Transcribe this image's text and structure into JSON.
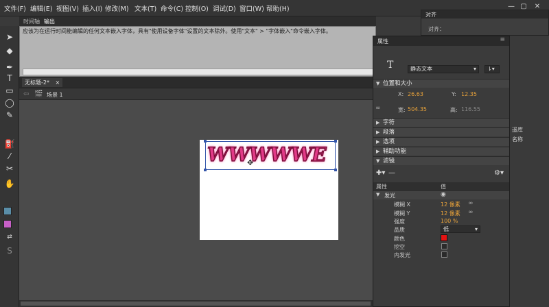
{
  "menu": [
    "文件(F)",
    "编辑(E)",
    "视图(V)",
    "插入(I)",
    "修改(M)",
    "文本(T)",
    "命令(C)",
    "控制(O)",
    "调试(D)",
    "窗口(W)",
    "帮助(H)"
  ],
  "top_tabs": [
    "时间轴",
    "输出"
  ],
  "output_text": "应该为在运行时间能编辑的任何文本嵌入字体，具有\"使用设备字体\"设置的文本除外。使用\"文本\" > \"字体嵌入\"命令嵌入字体。",
  "doc_tab": "无标题-2*",
  "doc_tab_close": "×",
  "scene_label": "场景 1",
  "stage_text": "WWWWWE",
  "align_panel": {
    "title": "对齐",
    "label": "对齐："
  },
  "library_panel": {
    "item1": "遥库",
    "item2": "名称"
  },
  "properties": {
    "title": "属性",
    "text_type": "静态文本",
    "sections": {
      "position_size": "位置和大小",
      "character": "字符",
      "paragraph": "段落",
      "options": "选项",
      "accessibility": "辅助功能",
      "filters": "滤镜"
    },
    "x_label": "X:",
    "x_value": "26.63",
    "y_label": "Y:",
    "y_value": "12.35",
    "w_label": "宽:",
    "w_value": "504.35",
    "h_label": "高:",
    "h_value": "116.55",
    "filter_header": {
      "attribute": "属性",
      "value": "值"
    },
    "filter_name": "发光",
    "rows": [
      {
        "label": "模糊 X",
        "value": "12 像素"
      },
      {
        "label": "模糊 Y",
        "value": "12 像素"
      },
      {
        "label": "强度",
        "value": "100 %"
      },
      {
        "label": "品质",
        "value": "低"
      },
      {
        "label": "颜色",
        "value": ""
      },
      {
        "label": "挖空",
        "value": ""
      },
      {
        "label": "内发光",
        "value": ""
      }
    ],
    "glow_color": "#e31313"
  }
}
